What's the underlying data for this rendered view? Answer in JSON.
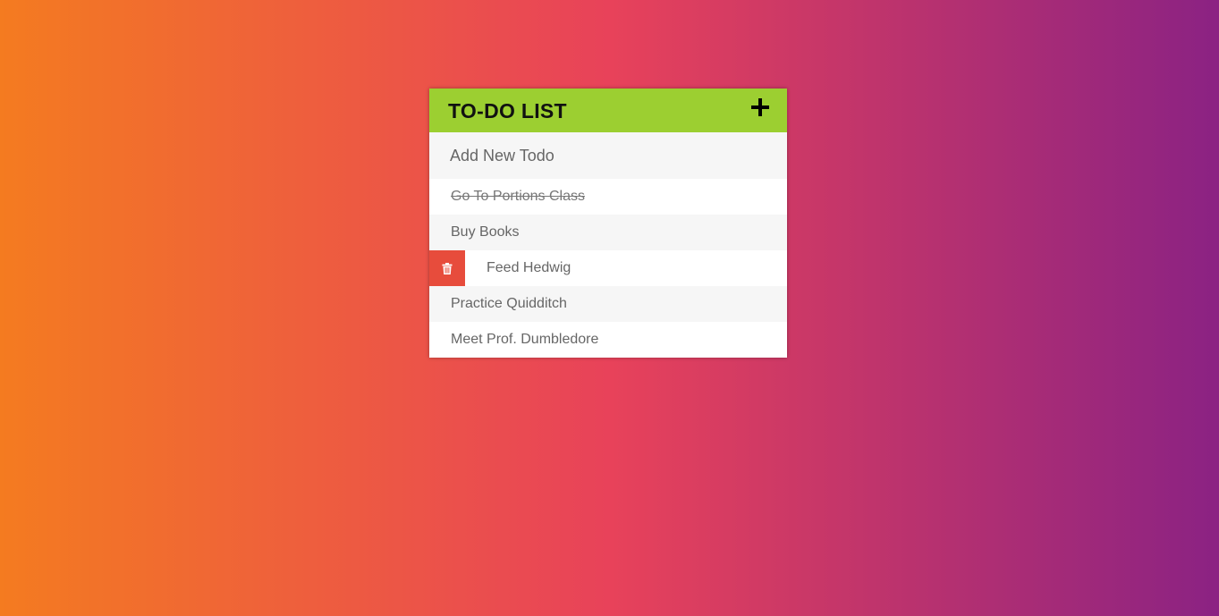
{
  "header": {
    "title": "TO-DO LIST",
    "add_icon": "plus-icon"
  },
  "new_todo": {
    "placeholder": "Add New Todo",
    "value": ""
  },
  "todos": [
    {
      "label": "Go To Portions Class",
      "completed": true
    },
    {
      "label": "Buy Books",
      "completed": false
    },
    {
      "label": "Feed Hedwig",
      "completed": false,
      "delete_visible": true,
      "delete_icon": "trash-icon"
    },
    {
      "label": "Practice Quidditch",
      "completed": false
    },
    {
      "label": "Meet Prof. Dumbledore",
      "completed": false
    }
  ],
  "colors": {
    "header_bg": "#9ccf31",
    "delete_bg": "#e74c3c",
    "gradient_start": "#f47b20",
    "gradient_mid": "#e8425a",
    "gradient_end": "#8b2283"
  }
}
